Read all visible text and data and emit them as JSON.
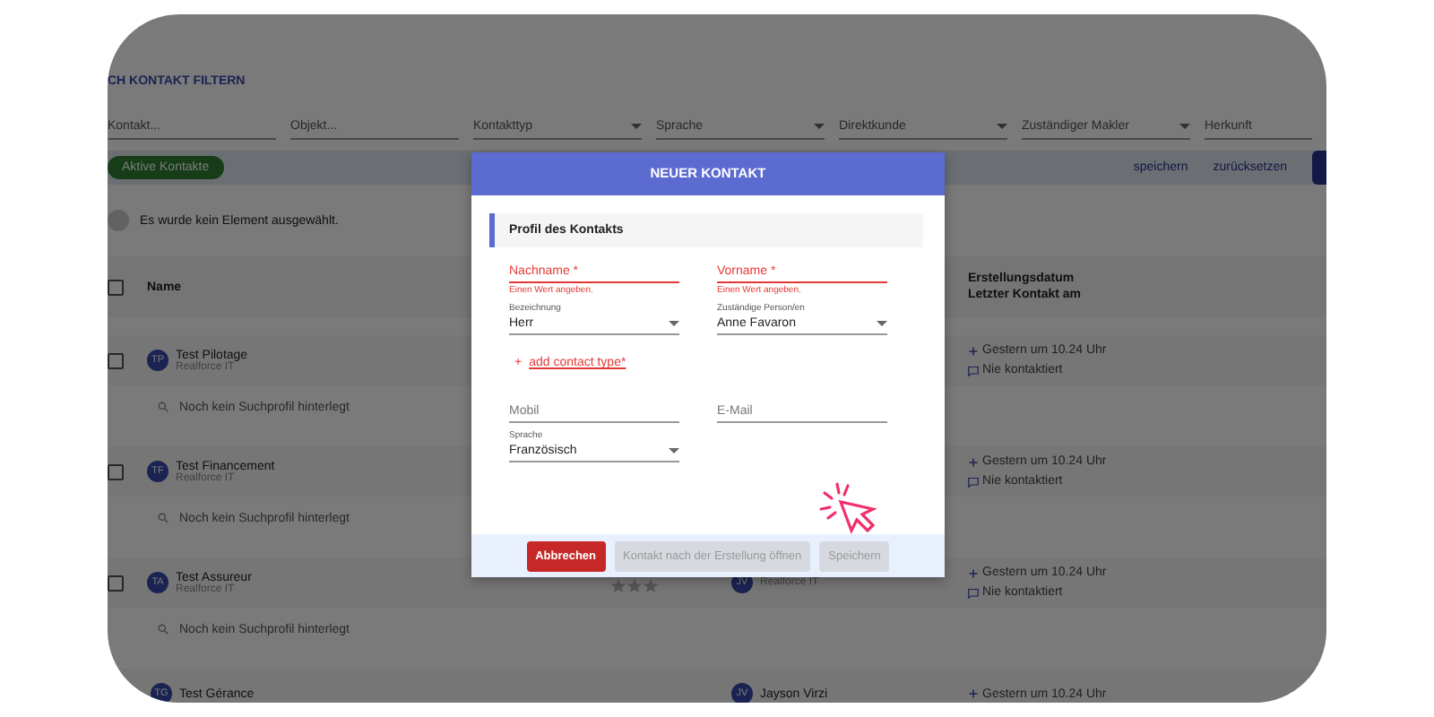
{
  "page": {
    "title": "CH KONTAKT FILTERN",
    "filters": [
      {
        "kind": "input",
        "placeholder": "Kontakt..."
      },
      {
        "kind": "input",
        "placeholder": "Objekt..."
      },
      {
        "kind": "select",
        "placeholder": "Kontakttyp"
      },
      {
        "kind": "select",
        "placeholder": "Sprache"
      },
      {
        "kind": "select",
        "placeholder": "Direktkunde"
      },
      {
        "kind": "select",
        "placeholder": "Zuständiger Makler"
      },
      {
        "kind": "input",
        "placeholder": "Herkunft"
      }
    ],
    "chip": "Aktive Kontakte",
    "actions": [
      "speichern",
      "zurücksetzen"
    ],
    "selection_info": "Es wurde kein Element ausgewählt.",
    "select_all_checked": false,
    "columns": {
      "name": "Name",
      "dates": [
        "Erstellungsdatum",
        "Letzter Kontakt am"
      ]
    },
    "rows": [
      {
        "checked": false,
        "initials": "TP",
        "name": "Test Pilotage",
        "company": "Realforce IT",
        "search_profile": "Noch kein Suchprofil hinterlegt",
        "created": "Gestern um 10.24 Uhr",
        "last_contact": "Nie kontaktiert"
      },
      {
        "checked": false,
        "initials": "TF",
        "name": "Test Financement",
        "company": "Realforce IT",
        "search_profile": "Noch kein Suchprofil hinterlegt",
        "created": "Gestern um 10.24 Uhr",
        "last_contact": "Nie kontaktiert"
      },
      {
        "checked": false,
        "initials": "TA",
        "name": "Test Assureur",
        "company": "Realforce IT",
        "search_profile": "Noch kein Suchprofil hinterlegt",
        "stars": 0,
        "broker": {
          "initials": "JV",
          "company": "Realforce IT"
        },
        "created": "Gestern um 10.24 Uhr",
        "last_contact": "Nie kontaktiert"
      },
      {
        "initials": "TG",
        "name": "Test Gérance",
        "broker": {
          "initials": "JV",
          "name": "Jayson Virzi"
        },
        "created": "Gestern um 10.24 Uhr"
      }
    ]
  },
  "modal": {
    "title": "NEUER KONTAKT",
    "section": "Profil des Kontakts",
    "fields_top": [
      {
        "kind": "input",
        "placeholder": "Nachname *",
        "error": "Einen Wert angeben."
      },
      {
        "kind": "input",
        "placeholder": "Vorname *",
        "error": "Einen Wert angeben."
      },
      {
        "kind": "select",
        "label": "Bezeichnung",
        "value": "Herr"
      },
      {
        "kind": "select",
        "label": "Zuständige Person/en",
        "value": "Anne Favaron"
      }
    ],
    "add_link": {
      "icon": "+",
      "label": "add contact type*"
    },
    "fields_bottom": [
      {
        "kind": "input",
        "placeholder": "Mobil"
      },
      {
        "kind": "input",
        "placeholder": "E-Mail"
      },
      {
        "kind": "select",
        "label": "Sprache",
        "value": "Französisch"
      }
    ],
    "buttons": [
      {
        "label": "Abbrechen",
        "disabled": false
      },
      {
        "label": "Kontakt nach der Erstellung öffnen",
        "disabled": true
      },
      {
        "label": "Speichern",
        "disabled": true
      }
    ]
  }
}
